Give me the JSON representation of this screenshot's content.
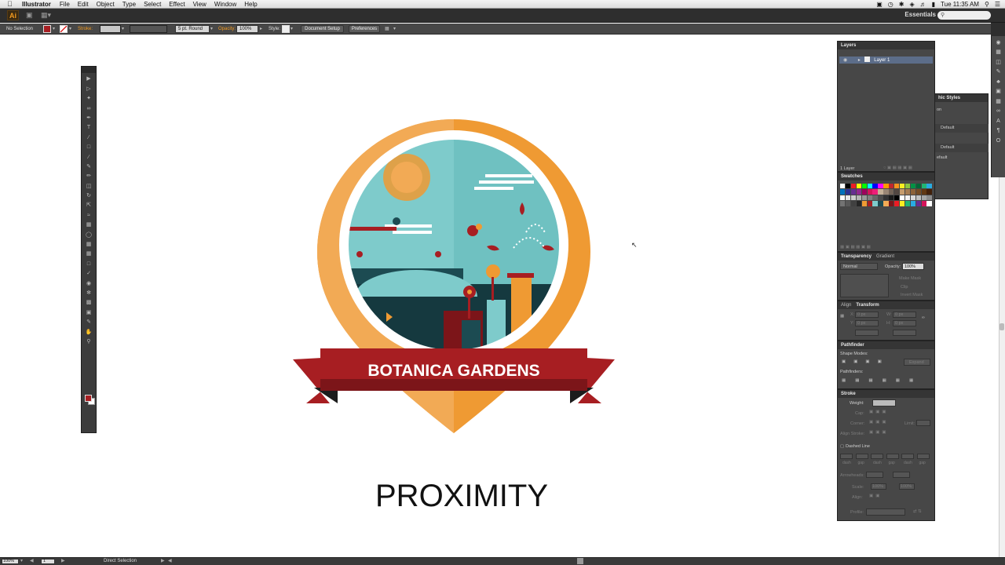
{
  "menubar": {
    "apple": "",
    "app_name": "Illustrator",
    "menus": [
      "File",
      "Edit",
      "Object",
      "Type",
      "Select",
      "Effect",
      "View",
      "Window",
      "Help"
    ],
    "clock": "Tue 11:35 AM"
  },
  "appbar": {
    "logo": "Ai",
    "workspace": "Essentials"
  },
  "controlbar": {
    "selection": "No Selection",
    "fill_color": "#a71e22",
    "stroke_label": "Stroke:",
    "brush_value": "5 pt. Round",
    "opacity_label": "Opacity:",
    "opacity_value": "100%",
    "style_label": "Style:",
    "document_setup": "Document Setup",
    "preferences": "Preferences"
  },
  "artwork": {
    "badge_title": "BOTANICA GARDENS",
    "caption": "PROXIMITY",
    "colors": {
      "orange": "#ef9a33",
      "orange_light": "#f2aa55",
      "red": "#a71e22",
      "red_dark": "#7c1519",
      "teal": "#7ecbcb",
      "teal_dark": "#1c4b52",
      "white": "#ffffff"
    }
  },
  "layers_panel": {
    "title": "Layers",
    "layer_name": "Layer 1",
    "footer": "1 Layer"
  },
  "swatches_panel": {
    "title": "Swatches",
    "colors": [
      "#ffffff",
      "#000000",
      "#ed1c24",
      "#ffff00",
      "#00ff00",
      "#00ffff",
      "#0000ff",
      "#ff00ff",
      "#ff9900",
      "#c1272d",
      "#f7931e",
      "#fcee21",
      "#8cc63f",
      "#009245",
      "#006837",
      "#22b573",
      "#29abe2",
      "#0071bc",
      "#2e3192",
      "#662d91",
      "#93278f",
      "#9e005d",
      "#d4145a",
      "#ed1e79",
      "#c7b299",
      "#998675",
      "#736357",
      "#534741",
      "#c69c6d",
      "#a67c52",
      "#8c6239",
      "#754c24",
      "#603813",
      "#42210b",
      "#ffffff",
      "#e6e6e6",
      "#cccccc",
      "#b3b3b3",
      "#999999",
      "#808080",
      "#666666",
      "#4d4d4d",
      "#333333",
      "#1a1a1a",
      "#000000",
      "#ffffff",
      "#f2f2f2",
      "#d9d9d9",
      "#bfbfbf",
      "#a6a6a6",
      "#8c8c8c",
      "#737373",
      "#595959",
      "#404040",
      "#262626",
      "#ef9a33",
      "#a71e22",
      "#7ecbcb",
      "#1c4b52",
      "#f2aa55",
      "#7c1519",
      "#ed1c24",
      "#fcee21",
      "#22b573",
      "#29abe2",
      "#662d91",
      "#d4145a",
      "#ffffff"
    ]
  },
  "transparency_panel": {
    "tab1": "Transparency",
    "tab2": "Gradient",
    "blend_mode": "Normal",
    "opacity_label": "Opacity:",
    "opacity_value": "100%",
    "make_mask": "Make Mask",
    "clip": "Clip",
    "invert_mask": "Invert Mask"
  },
  "transform_panel": {
    "tab1": "Align",
    "tab2": "Transform",
    "x": "0 px",
    "y": "0 px",
    "w": "0 px",
    "h": "0 px"
  },
  "pathfinder_panel": {
    "title": "Pathfinder",
    "shape_modes": "Shape Modes:",
    "expand": "Expand",
    "pathfinders": "Pathfinders:"
  },
  "stroke_panel": {
    "title": "Stroke",
    "weight": "Weight:",
    "cap": "Cap:",
    "corner": "Corner:",
    "limit": "Limit:",
    "align_stroke": "Align Stroke:",
    "dashed_line": "Dashed Line",
    "dash_labels": [
      "dash",
      "gap",
      "dash",
      "gap",
      "dash",
      "gap"
    ],
    "arrowheads": "Arrowheads:",
    "scale": "Scale:",
    "scale_values": [
      "100%",
      "100%"
    ],
    "align": "Align:",
    "profile": "Profile:"
  },
  "graphic_styles_panel": {
    "title": "hic Styles",
    "row_icon": "on",
    "items": [
      "Default",
      "Default",
      "efault"
    ]
  },
  "statusbar": {
    "zoom": "100%",
    "artboard": "1",
    "tool": "Direct Selection"
  }
}
